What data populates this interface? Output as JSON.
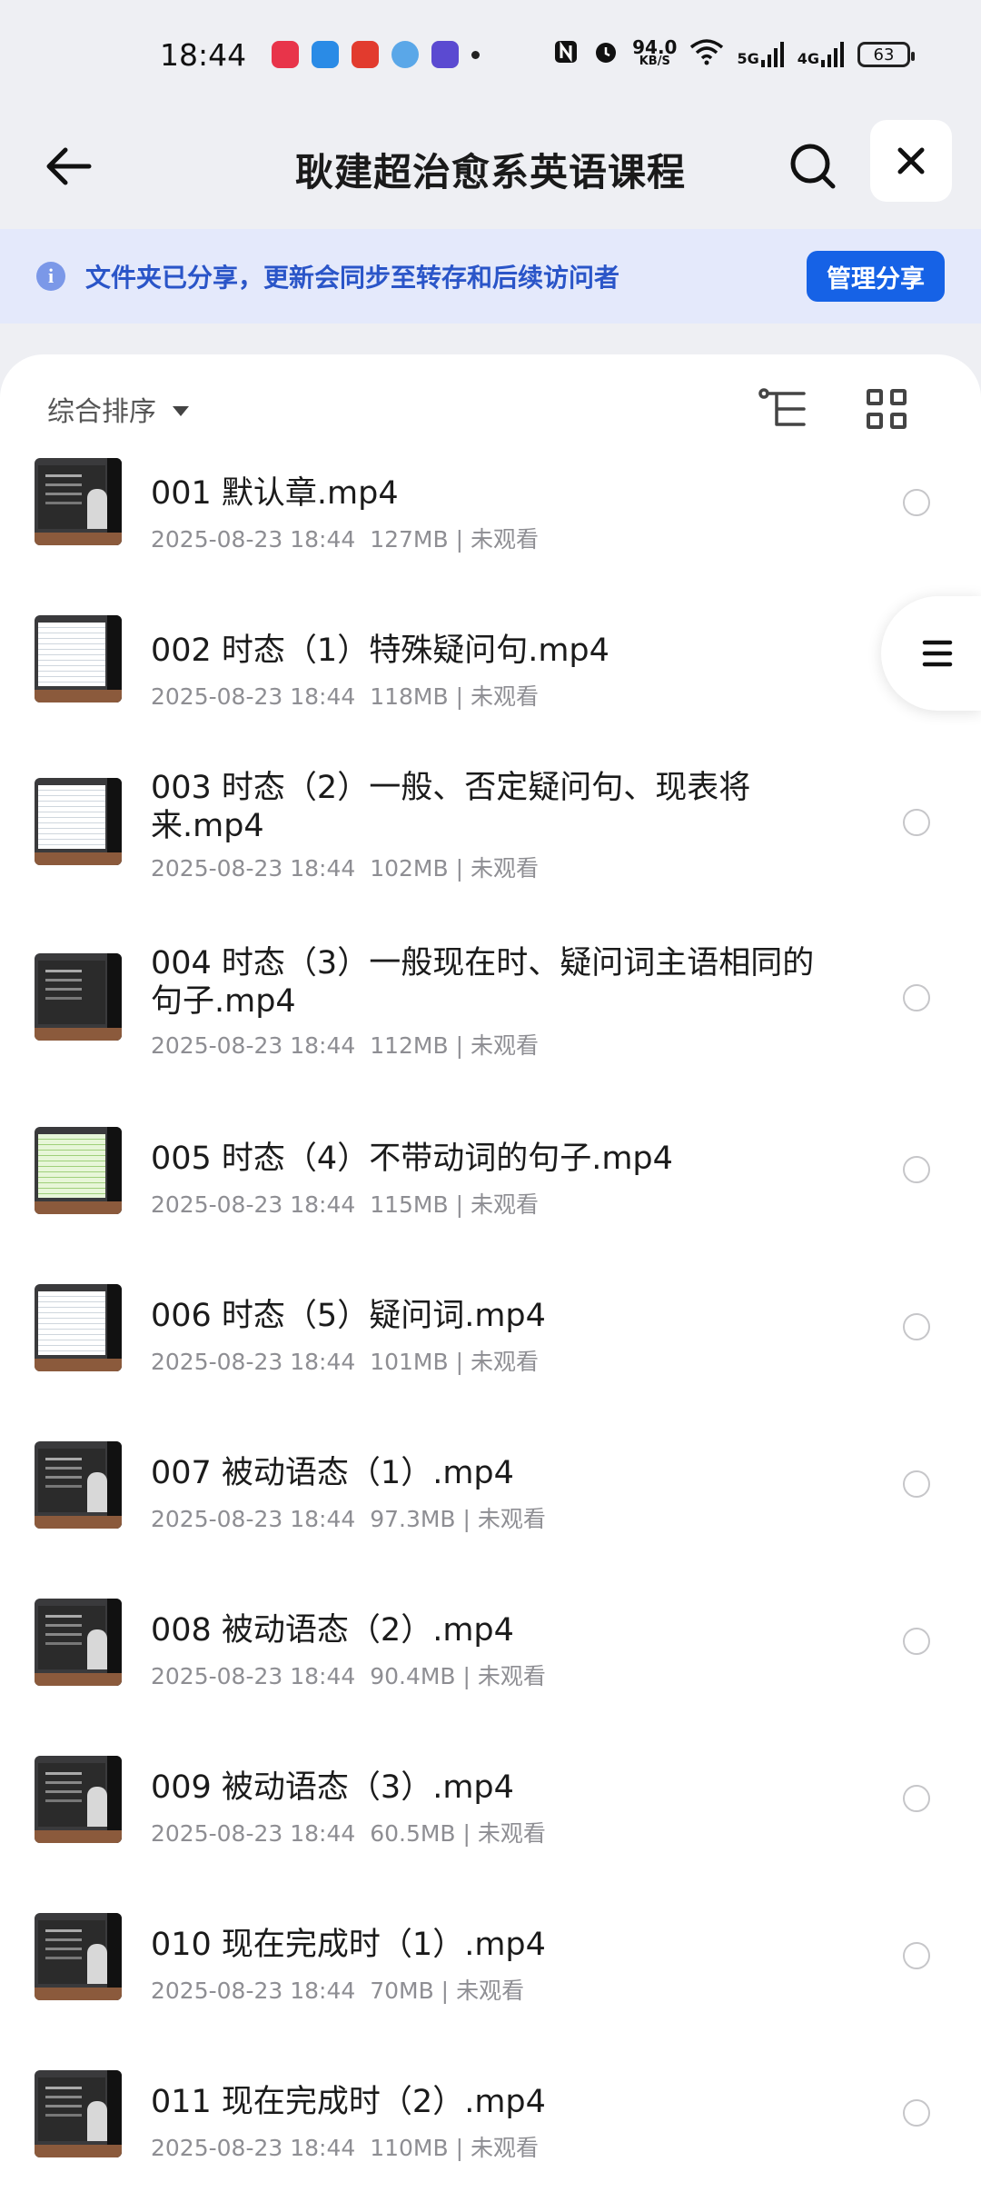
{
  "status_bar": {
    "time": "18:44",
    "net_speed_value": "94.0",
    "net_speed_unit": "KB/S",
    "sig1": "5G",
    "sig2": "4G",
    "battery": "63"
  },
  "header": {
    "title": "耿建超治愈系英语课程"
  },
  "banner": {
    "text": "文件夹已分享，更新会同步至转存和后续访问者",
    "button": "管理分享"
  },
  "sort": {
    "label": "综合排序"
  },
  "files": [
    {
      "name": "001  默认章.mp4",
      "date": "2025-08-23 18:44",
      "size": "127MB",
      "status": "未观看"
    },
    {
      "name": "002  时态（1）特殊疑问句.mp4",
      "date": "2025-08-23 18:44",
      "size": "118MB",
      "status": "未观看"
    },
    {
      "name": "003  时态（2）一般、否定疑问句、现表将来.mp4",
      "date": "2025-08-23 18:44",
      "size": "102MB",
      "status": "未观看"
    },
    {
      "name": "004  时态（3）一般现在时、疑问词主语相同的句子.mp4",
      "date": "2025-08-23 18:44",
      "size": "112MB",
      "status": "未观看"
    },
    {
      "name": "005  时态（4）不带动词的句子.mp4",
      "date": "2025-08-23 18:44",
      "size": "115MB",
      "status": "未观看"
    },
    {
      "name": "006  时态（5）疑问词.mp4",
      "date": "2025-08-23 18:44",
      "size": "101MB",
      "status": "未观看"
    },
    {
      "name": "007  被动语态（1）.mp4",
      "date": "2025-08-23 18:44",
      "size": "97.3MB",
      "status": "未观看"
    },
    {
      "name": "008  被动语态（2）.mp4",
      "date": "2025-08-23 18:44",
      "size": "90.4MB",
      "status": "未观看"
    },
    {
      "name": "009  被动语态（3）.mp4",
      "date": "2025-08-23 18:44",
      "size": "60.5MB",
      "status": "未观看"
    },
    {
      "name": "010  现在完成时（1）.mp4",
      "date": "2025-08-23 18:44",
      "size": "70MB",
      "status": "未观看"
    },
    {
      "name": "011  现在完成时（2）.mp4",
      "date": "2025-08-23 18:44",
      "size": "110MB",
      "status": "未观看"
    }
  ]
}
